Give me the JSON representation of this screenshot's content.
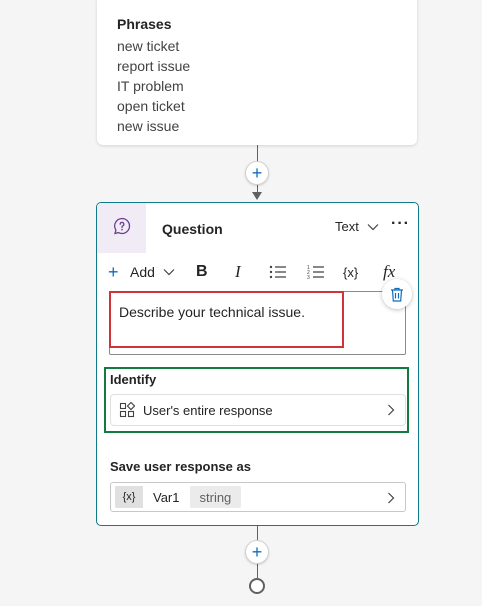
{
  "phrases": {
    "title": "Phrases",
    "items": [
      "new ticket",
      "report issue",
      "IT problem",
      "open ticket",
      "new issue"
    ]
  },
  "add_node_symbol": "+",
  "question": {
    "title": "Question",
    "type_label": "Text",
    "more_label": "···",
    "toolbar": {
      "add_label": "Add",
      "bold": "B",
      "italic": "I",
      "variable": "{x}",
      "formula": "fx"
    },
    "message_text": "Describe your technical issue.",
    "identify": {
      "label": "Identify",
      "value": "User's entire response"
    },
    "save_response": {
      "label": "Save user response as",
      "var_icon": "{x}",
      "var_name": "Var1",
      "var_type": "string"
    }
  },
  "colors": {
    "accent": "#0f6cbd",
    "card_border": "#0e7a8a",
    "highlight_red": "#d13438",
    "highlight_green": "#107c41",
    "question_icon_bg": "#f1ebf6",
    "question_icon": "#6b3f8f"
  },
  "icons": [
    "chat-help-icon",
    "chevron-down-icon",
    "more-icon",
    "bold-icon",
    "italic-icon",
    "bullet-list-icon",
    "numbered-list-icon",
    "variable-icon",
    "formula-icon",
    "trash-icon",
    "identify-entity-icon",
    "chevron-right-icon"
  ]
}
